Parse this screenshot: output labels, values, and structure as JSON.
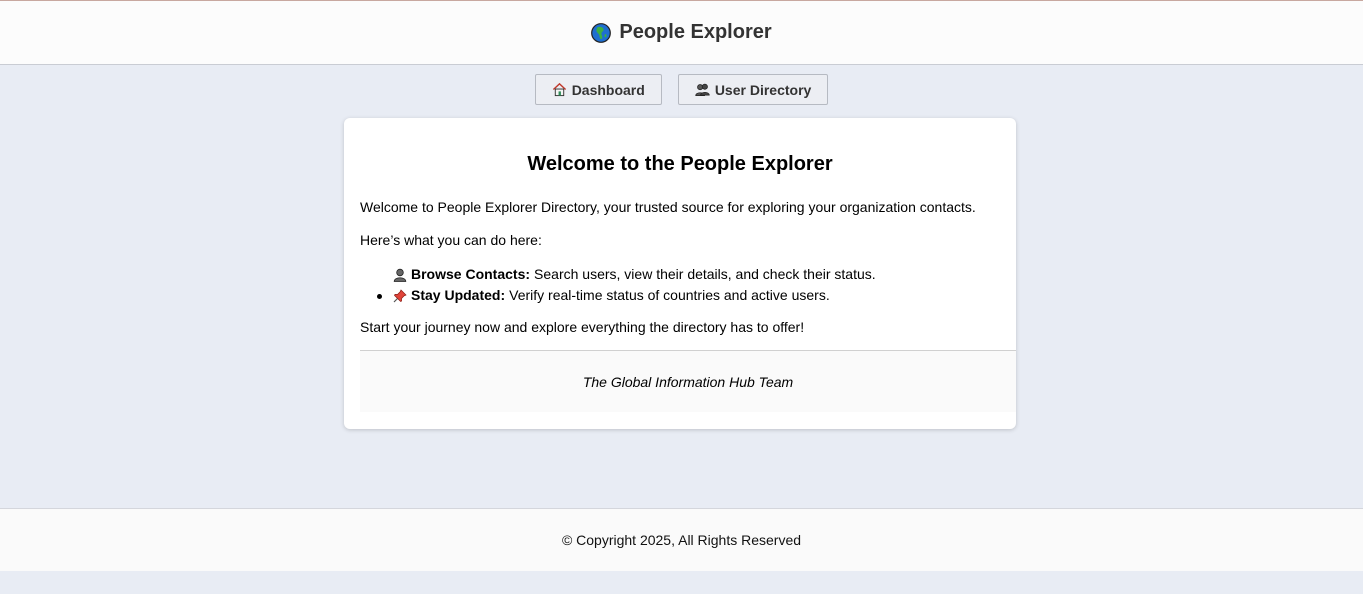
{
  "header": {
    "title": "People Explorer",
    "logo_icon": "globe-icon"
  },
  "nav": {
    "items": [
      {
        "label": "Dashboard",
        "icon": "house-icon"
      },
      {
        "label": "User Directory",
        "icon": "users-icon"
      }
    ]
  },
  "card": {
    "heading": "Welcome to the People Explorer",
    "intro": "Welcome to People Explorer Directory, your trusted source for exploring your organization contacts.",
    "lead": "Here’s what you can do here:",
    "features": [
      {
        "icon": "user-silhouette-icon",
        "title": "Browse Contacts:",
        "text": "Search users, view their details, and check their status."
      },
      {
        "icon": "pushpin-icon",
        "title": "Stay Updated:",
        "text": "Verify real-time status of countries and active users."
      }
    ],
    "closing": "Start your journey now and explore everything the directory has to offer!",
    "signoff": "The Global Information Hub Team"
  },
  "footer": {
    "copyright": "© Copyright 2025, All Rights Reserved"
  },
  "colors": {
    "page_bg": "#e8ecf4",
    "header_bg": "#fcfcfc",
    "card_bg": "#ffffff"
  }
}
